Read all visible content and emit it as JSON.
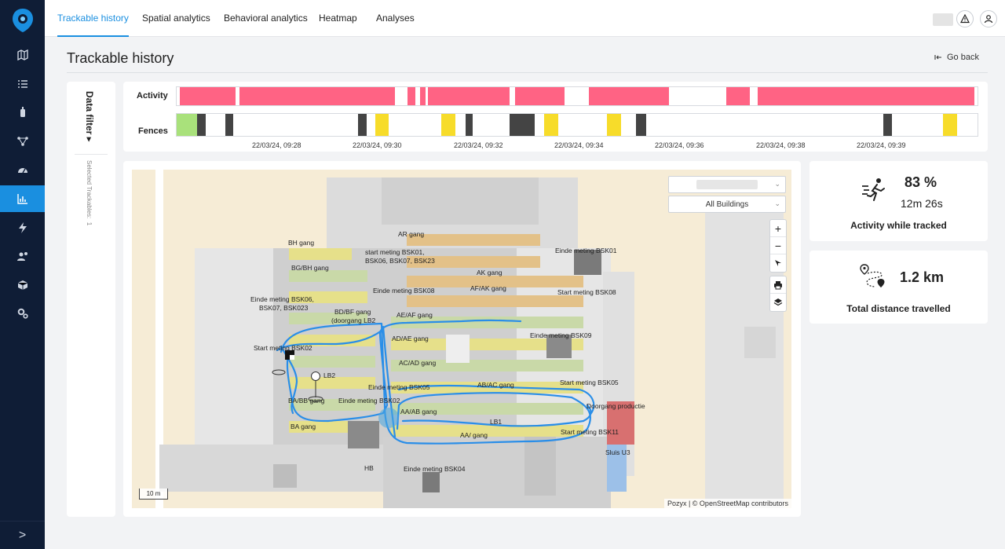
{
  "nav": {
    "tabs": [
      "Trackable history",
      "Spatial analytics",
      "Behavioral analytics",
      "Heatmap",
      "Analyses"
    ],
    "active_tab": "Trackable history"
  },
  "sidebar": {
    "icons": [
      "map-icon",
      "list-icon",
      "tag-icon",
      "network-icon",
      "dashboard-icon",
      "bar-chart-icon",
      "lightning-icon",
      "people-settings-icon",
      "cube-icon",
      "gears-icon"
    ],
    "active": "bar-chart-icon",
    "expand_glyph": ">"
  },
  "header": {
    "title": "Trackable history",
    "go_back": "Go back"
  },
  "filter": {
    "title": "Data filter ▸",
    "selected_label": "Selected Trackables:",
    "selected_count": "1"
  },
  "timeline": {
    "activity_label": "Activity",
    "fences_label": "Fences",
    "ticks": [
      "22/03/24, 09:28",
      "22/03/24, 09:30",
      "22/03/24, 09:32",
      "22/03/24, 09:34",
      "22/03/24, 09:36",
      "22/03/24, 09:38",
      "22/03/24, 09:39"
    ],
    "colors": {
      "activity": "#ff6384",
      "fence_dark": "#444444",
      "fence_yellow": "#f7dc2a",
      "fence_green": "#a9e17b"
    }
  },
  "map": {
    "building_select": "All Buildings",
    "scale": "10 m",
    "attribution": "Pozyx | © OpenStreetMap contributors",
    "labels": [
      "AR gang",
      "BH gang",
      "start meting BSK01,",
      "BSK06, BSK07, BSK23",
      "Einde meting BSK01",
      "BG/BH gang",
      "AK gang",
      "Einde meting BSK08",
      "AF/AK gang",
      "Start meting BSK08",
      "Einde meting BSK06,",
      "BSK07, BSK023",
      "BD/BF gang",
      "(doorgang LB2",
      "AE/AF gang",
      "AD/AE gang",
      "Einde meting BSK09",
      "Start meting BSK02",
      "AC/AD gang",
      "LB2",
      "Einde meting BSK05",
      "AB/AC gang",
      "Start meting BSK05",
      "BA/BB gang",
      "Einde meting BSK02",
      "AA/AB gang",
      "Doorgang productie",
      "LB1",
      "BA gang",
      "AA/ gang",
      "Start meting BSK11",
      "Sluis U3",
      "HB",
      "Einde meting BSK04"
    ]
  },
  "stats": {
    "activity": {
      "value": "83 %",
      "duration": "12m 26s",
      "caption": "Activity while tracked"
    },
    "distance": {
      "value": "1.2 km",
      "caption": "Total distance travelled"
    }
  }
}
